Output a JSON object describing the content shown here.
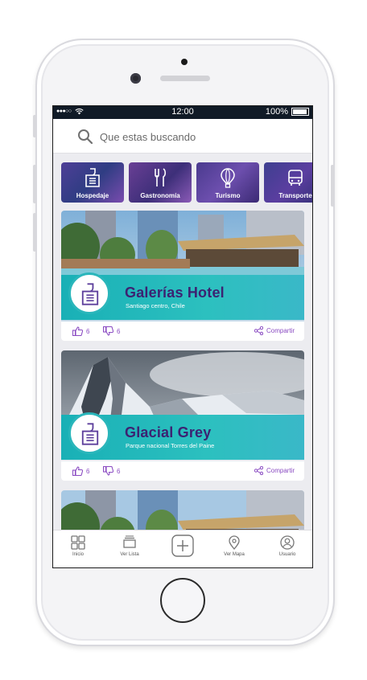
{
  "status_bar": {
    "signal": "●●●○○",
    "time": "12:00",
    "battery": "100%"
  },
  "search": {
    "placeholder": "Que estas buscando"
  },
  "categories": [
    {
      "label": "Hospedaje",
      "icon": "door-hanger-icon"
    },
    {
      "label": "Gastronomía",
      "icon": "fork-knife-icon"
    },
    {
      "label": "Turismo",
      "icon": "hot-air-balloon-icon"
    },
    {
      "label": "Transporte",
      "icon": "bus-icon"
    }
  ],
  "cards": [
    {
      "title": "Galerías Hotel",
      "subtitle": "Santiago centro, Chile",
      "likes": "6",
      "dislikes": "6",
      "share": "Compartir",
      "image": "hotel-pool"
    },
    {
      "title": "Glacial Grey",
      "subtitle": "Parque nacional Torres del Paine",
      "likes": "6",
      "dislikes": "6",
      "share": "Compartir",
      "image": "snowy-mountains"
    },
    {
      "title": "",
      "subtitle": "",
      "image": "hotel-pool"
    }
  ],
  "tabbar": [
    {
      "label": "Inicio",
      "icon": "grid-icon"
    },
    {
      "label": "Ver Lista",
      "icon": "list-icon"
    },
    {
      "label": "",
      "icon": "plus-icon"
    },
    {
      "label": "Ver Mapa",
      "icon": "map-pin-icon"
    },
    {
      "label": "Usuario",
      "icon": "user-icon"
    }
  ],
  "colors": {
    "accent": "#8a4bc2",
    "title": "#3c2272",
    "band": "#2cc0bf",
    "status_bar": "#101a26"
  }
}
